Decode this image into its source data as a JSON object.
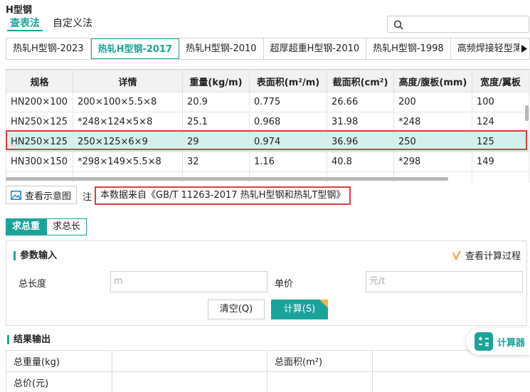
{
  "header": {
    "title": "H型钢"
  },
  "top_tabs": [
    {
      "label": "查表法",
      "active": true
    },
    {
      "label": "自定义法",
      "active": false
    }
  ],
  "search": {
    "placeholder": ""
  },
  "standard_tabs": [
    {
      "label": "热轧H型钢-2023",
      "active": false
    },
    {
      "label": "热轧H型钢-2017",
      "active": true
    },
    {
      "label": "热轧H型钢-2010",
      "active": false
    },
    {
      "label": "超厚超重H型钢-2010",
      "active": false
    },
    {
      "label": "热轧H型钢-1998",
      "active": false
    },
    {
      "label": "高频焊接轻型薄壁",
      "active": false
    }
  ],
  "table": {
    "headers": [
      "规格",
      "详情",
      "重量(kg/m)",
      "表面积(m²/m)",
      "截面积(cm²)",
      "高度/腹板(mm)",
      "宽度/翼板"
    ],
    "rows": [
      [
        "HN200×100",
        "200×100×5.5×8",
        "20.9",
        "0.775",
        "26.66",
        "200",
        "100"
      ],
      [
        "HN250×125",
        "*248×124×5×8",
        "25.1",
        "0.968",
        "31.98",
        "*248",
        "124"
      ],
      [
        "HN250×125",
        "250×125×6×9",
        "29",
        "0.974",
        "36.96",
        "250",
        "125"
      ],
      [
        "HN300×150",
        "*298×149×5.5×8",
        "32",
        "1.16",
        "40.8",
        "*298",
        "149"
      ]
    ],
    "selected_row": 2
  },
  "diagram_button": {
    "label": "查看示意图"
  },
  "note": {
    "label": "注",
    "text": "本数据来自《GB/T 11263-2017 热轧H型钢和热轧T型钢》"
  },
  "calc_tabs": [
    {
      "label": "求总重",
      "active": true
    },
    {
      "label": "求总长",
      "active": false
    }
  ],
  "params": {
    "title": "参数输入",
    "view_process": "查看计算过程",
    "length_label": "总长度",
    "length_placeholder": "m",
    "price_label": "单价",
    "price_placeholder": "元/t",
    "clear_label": "清空(Q)",
    "calc_label": "计算(S)"
  },
  "results": {
    "title": "结果输出",
    "total_weight_label": "总重量(kg)",
    "total_area_label": "总面积(m²)",
    "total_price_label": "总价(元)"
  },
  "calculator_widget": {
    "label": "计算器"
  },
  "colors": {
    "accent": "#1aa39a",
    "highlight": "#e03c3c",
    "selected_row": "#d4f0ec"
  }
}
